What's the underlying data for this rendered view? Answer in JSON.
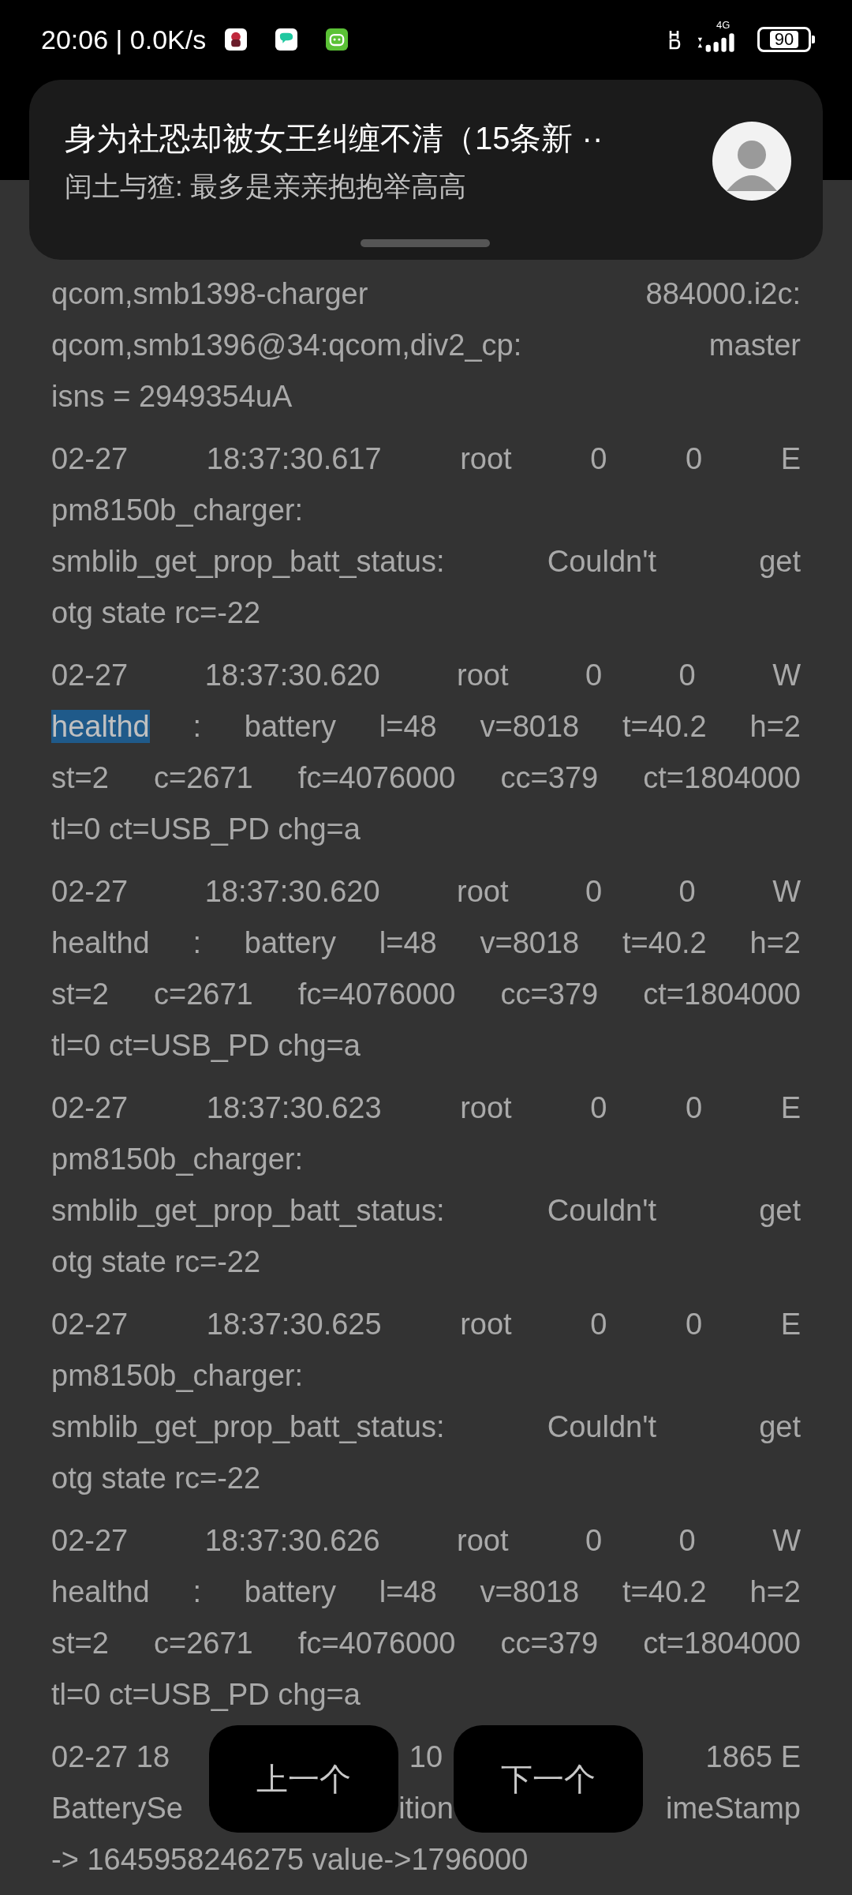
{
  "status_bar": {
    "time_speed": "20:06 | 0.0K/s",
    "network": "4G",
    "battery": "90"
  },
  "notification": {
    "title": "身为社恐却被女王纠缠不清（15条新 ··",
    "message": "闰土与猹: 最多是亲亲抱抱举高高"
  },
  "log_entries": [
    {
      "lines": [
        {
          "text": "qcom,smb1398-charger 884000.i2c:"
        },
        {
          "text": "qcom,smb1396@34:qcom,div2_cp: master"
        },
        {
          "text": "isns = 2949354uA"
        }
      ]
    },
    {
      "lines": [
        {
          "text": "02-27 18:37:30.617 root 0 0 E"
        },
        {
          "text": "pm8150b_charger:"
        },
        {
          "text": "smblib_get_prop_batt_status: Couldn't get"
        },
        {
          "text": "otg state rc=-22"
        }
      ]
    },
    {
      "lines": [
        {
          "text": "02-27 18:37:30.620 root 0 0 W"
        },
        {
          "match": "healthd",
          "text": " : battery l=48 v=8018 t=40.2 h=2"
        },
        {
          "text": "st=2 c=2671 fc=4076000 cc=379 ct=1804000"
        },
        {
          "text": "tl=0 ct=USB_PD chg=a"
        }
      ]
    },
    {
      "lines": [
        {
          "text": "02-27 18:37:30.620 root 0 0 W"
        },
        {
          "text": "healthd : battery l=48 v=8018 t=40.2 h=2"
        },
        {
          "text": "st=2 c=2671 fc=4076000 cc=379 ct=1804000"
        },
        {
          "text": "tl=0 ct=USB_PD chg=a"
        }
      ]
    },
    {
      "lines": [
        {
          "text": "02-27 18:37:30.623 root 0 0 E"
        },
        {
          "text": "pm8150b_charger:"
        },
        {
          "text": "smblib_get_prop_batt_status: Couldn't get"
        },
        {
          "text": "otg state rc=-22"
        }
      ]
    },
    {
      "lines": [
        {
          "text": "02-27 18:37:30.625 root 0 0 E"
        },
        {
          "text": "pm8150b_charger:"
        },
        {
          "text": "smblib_get_prop_batt_status: Couldn't get"
        },
        {
          "text": "otg state rc=-22"
        }
      ]
    },
    {
      "lines": [
        {
          "text": "02-27 18:37:30.626 root 0 0 W"
        },
        {
          "text": "healthd : battery l=48 v=8018 t=40.2 h=2"
        },
        {
          "text": "st=2 c=2671 fc=4076000 cc=379 ct=1804000"
        },
        {
          "text": "tl=0 ct=USB_PD chg=a"
        }
      ]
    }
  ],
  "partial_entry": {
    "line_1": [
      "02-27 18",
      "10",
      "1865 E"
    ],
    "line_2": [
      "BatterySe",
      "ition",
      "imeStamp"
    ],
    "line_3": "-> 1645958246275 value->1796000"
  },
  "buttons": {
    "previous": "上一个",
    "next": "下一个"
  }
}
